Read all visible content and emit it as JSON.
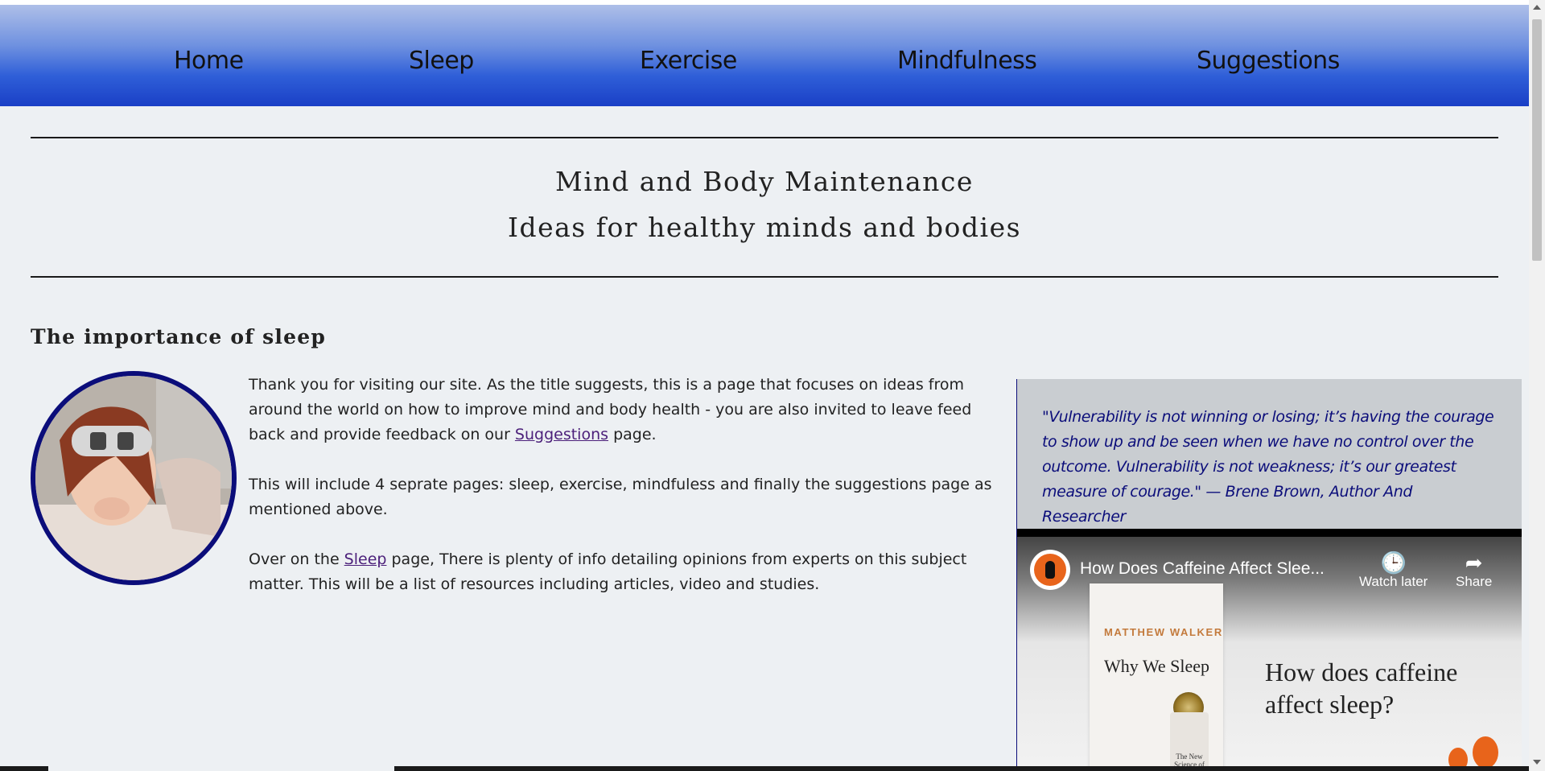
{
  "nav": {
    "items": [
      {
        "label": "Home"
      },
      {
        "label": "Sleep"
      },
      {
        "label": "Exercise"
      },
      {
        "label": "Mindfulness"
      },
      {
        "label": "Suggestions"
      }
    ]
  },
  "header": {
    "title": "Mind and Body Maintenance",
    "subtitle": "Ideas for healthy minds and bodies"
  },
  "section": {
    "heading": "The importance of sleep",
    "image_alt": "woman yawning with sleep mask"
  },
  "content": {
    "p1_before": "Thank you for visiting our site. As the title suggests, this is a page that focuses on ideas from around the world on how to improve mind and body health - you are also invited to leave feed back and provide feedback on our ",
    "p1_link": "Suggestions",
    "p1_after": " page.",
    "p2": "This will include 4 seprate pages: sleep, exercise, mindfuless and finally the suggestions page as mentioned above.",
    "p3_before": "Over on the ",
    "p3_link": "Sleep",
    "p3_after": " page, There is plenty of info detailing opinions from experts on this subject matter. This will be a list of resources including articles, video and studies."
  },
  "quote": {
    "text": "\"Vulnerability is not winning or losing; it’s having the courage to show up and be seen when we have no control over the outcome. Vulnerability is not weakness; it’s our greatest measure of courage.\" — Brene Brown, Author And Researcher"
  },
  "video": {
    "title": "How Does Caffeine Affect Slee...",
    "watch_later": "Watch later",
    "share": "Share",
    "book_author": "MATTHEW WALKER",
    "book_title": "Why We Sleep",
    "book_small": "The New Science of Sleep and Dreams",
    "caption": "How does caffeine affect sleep?"
  },
  "colors": {
    "nav_gradient_top": "#aebfe8",
    "nav_gradient_bottom": "#1a3fc6",
    "quote_text": "#0b0d7a",
    "link": "#4b1f7a",
    "page_bg": "#edf0f3"
  }
}
